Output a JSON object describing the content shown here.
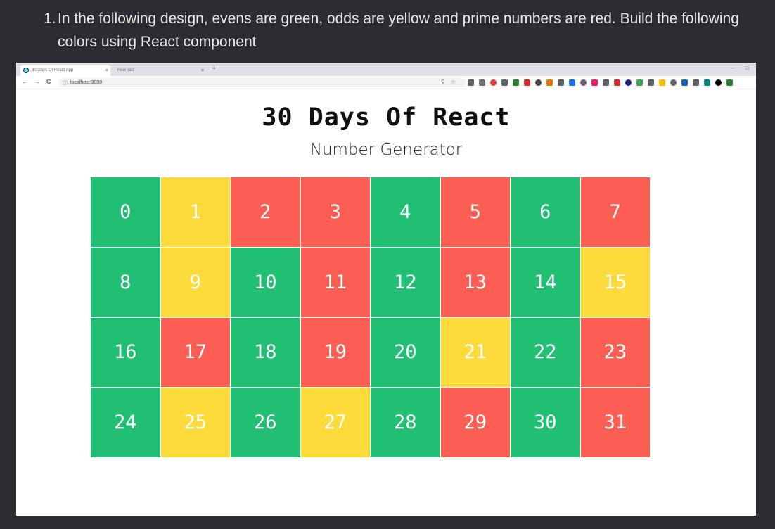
{
  "instruction": {
    "number": "1.",
    "text": "In the following design, evens are green, odds are yellow and prime numbers are red. Build the following colors using React component"
  },
  "browser": {
    "tabs": [
      {
        "label": "30 Days Of React App",
        "close": "×"
      },
      {
        "label": "New Tab",
        "close": "×"
      }
    ],
    "new_tab": "+",
    "window_controls": [
      "–",
      "□"
    ],
    "nav": {
      "back": "←",
      "forward": "→",
      "reload": "C"
    },
    "address": "localhost:3000",
    "address_info_icon": "ⓘ",
    "omnibox_icons": [
      "⚲",
      "☆"
    ],
    "extension_colors": [
      "#5f6368",
      "#6d7175",
      "#e53935",
      "#5f6368",
      "#2e7d32",
      "#d32f2f",
      "#444444",
      "#e8710a",
      "#5f6368",
      "#1a73e8",
      "#5f6368",
      "#e91e63",
      "#5f6368",
      "#d32f2f",
      "#1a237e",
      "#34a853",
      "#5f6368",
      "#fbbc04",
      "#5f6368",
      "#1565c0",
      "#5f6368",
      "#00897b",
      "#000000",
      "#2e7d32"
    ]
  },
  "app": {
    "title": "30 Days Of React",
    "subtitle": "Number Generator"
  },
  "colors": {
    "even": "#21bf73",
    "odd": "#fddb3a",
    "prime": "#fd5e53"
  },
  "cells": [
    {
      "n": "0",
      "type": "even"
    },
    {
      "n": "1",
      "type": "odd"
    },
    {
      "n": "2",
      "type": "prime"
    },
    {
      "n": "3",
      "type": "prime"
    },
    {
      "n": "4",
      "type": "even"
    },
    {
      "n": "5",
      "type": "prime"
    },
    {
      "n": "6",
      "type": "even"
    },
    {
      "n": "7",
      "type": "prime"
    },
    {
      "n": "8",
      "type": "even"
    },
    {
      "n": "9",
      "type": "odd"
    },
    {
      "n": "10",
      "type": "even"
    },
    {
      "n": "11",
      "type": "prime"
    },
    {
      "n": "12",
      "type": "even"
    },
    {
      "n": "13",
      "type": "prime"
    },
    {
      "n": "14",
      "type": "even"
    },
    {
      "n": "15",
      "type": "odd"
    },
    {
      "n": "16",
      "type": "even"
    },
    {
      "n": "17",
      "type": "prime"
    },
    {
      "n": "18",
      "type": "even"
    },
    {
      "n": "19",
      "type": "prime"
    },
    {
      "n": "20",
      "type": "even"
    },
    {
      "n": "21",
      "type": "odd"
    },
    {
      "n": "22",
      "type": "even"
    },
    {
      "n": "23",
      "type": "prime"
    },
    {
      "n": "24",
      "type": "even"
    },
    {
      "n": "25",
      "type": "odd"
    },
    {
      "n": "26",
      "type": "even"
    },
    {
      "n": "27",
      "type": "odd"
    },
    {
      "n": "28",
      "type": "even"
    },
    {
      "n": "29",
      "type": "prime"
    },
    {
      "n": "30",
      "type": "even"
    },
    {
      "n": "31",
      "type": "prime"
    }
  ]
}
